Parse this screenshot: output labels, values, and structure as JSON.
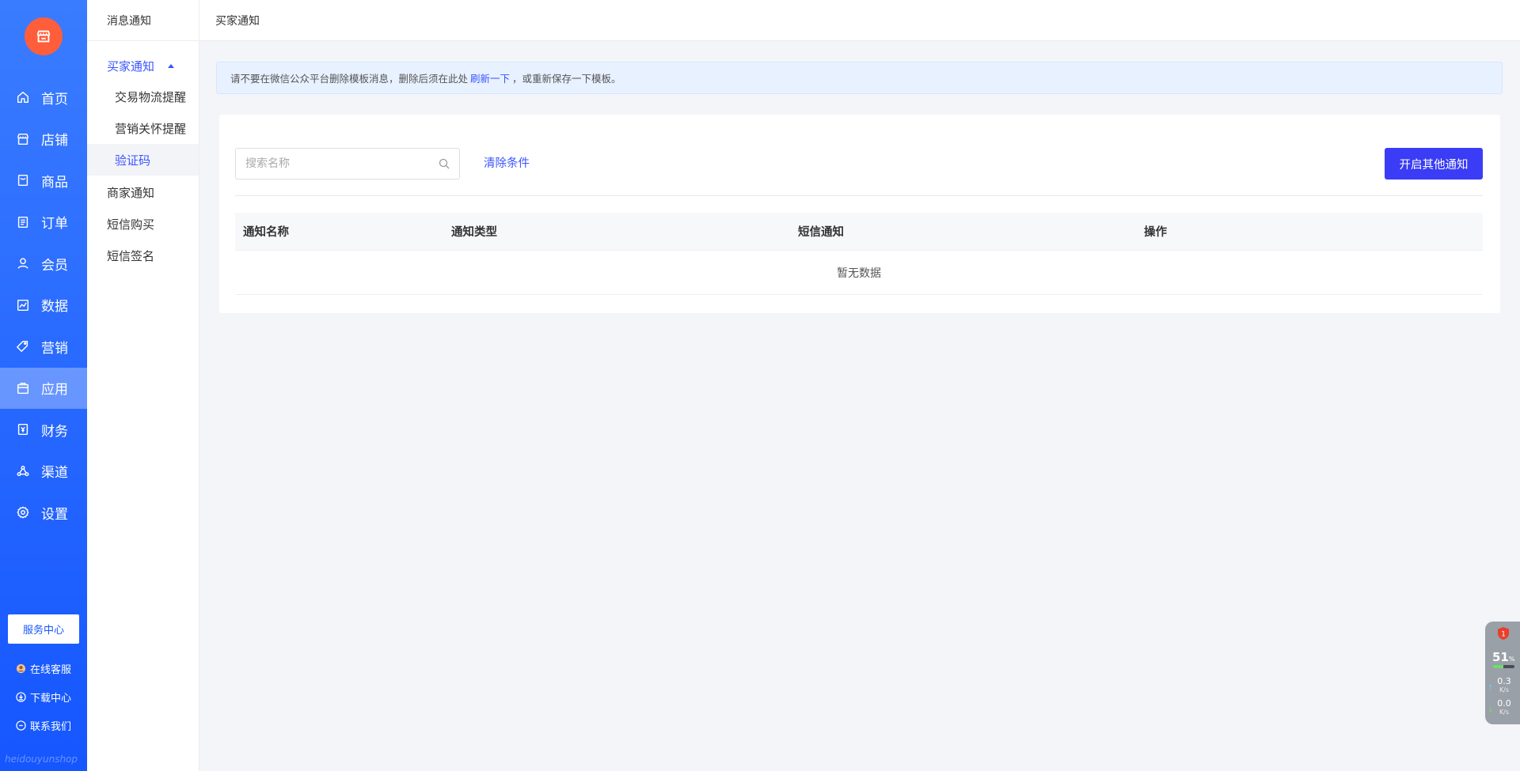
{
  "nav": {
    "items": [
      {
        "label": "首页",
        "icon": "home-icon"
      },
      {
        "label": "店铺",
        "icon": "store-icon"
      },
      {
        "label": "商品",
        "icon": "goods-icon"
      },
      {
        "label": "订单",
        "icon": "order-icon"
      },
      {
        "label": "会员",
        "icon": "member-icon"
      },
      {
        "label": "数据",
        "icon": "chart-icon"
      },
      {
        "label": "营销",
        "icon": "tag-icon"
      },
      {
        "label": "应用",
        "icon": "app-icon"
      },
      {
        "label": "财务",
        "icon": "finance-icon"
      },
      {
        "label": "渠道",
        "icon": "channel-icon"
      },
      {
        "label": "设置",
        "icon": "gear-icon"
      }
    ],
    "active_index": 7,
    "service_label": "服务中心",
    "online_service": "在线客服",
    "download_center": "下载中心",
    "contact_us": "联系我们",
    "watermark": "heidouyunshop"
  },
  "subnav": {
    "title": "消息通知",
    "group_buyer": "买家通知",
    "items": [
      "交易物流提醒",
      "营销关怀提醒",
      "验证码"
    ],
    "group_merchant": "商家通知",
    "group_sms_buy": "短信购买",
    "group_sms_sign": "短信签名"
  },
  "topbar": {
    "title": "买家通知"
  },
  "alert": {
    "before": "请不要在微信公众平台删除模板消息，删除后须在此处",
    "link": "刷新一下",
    "after": "，或重新保存一下模板。"
  },
  "search": {
    "placeholder": "搜索名称"
  },
  "clear_label": "清除条件",
  "primary_label": "开启其他通知",
  "table": {
    "headers": [
      "通知名称",
      "通知类型",
      "短信通知",
      "操作"
    ],
    "empty_text": "暂无数据"
  },
  "widget": {
    "percent": "51",
    "percent_unit": "%",
    "badge": "1",
    "cpu_fill": 0.51,
    "up_speed": "0.3",
    "down_speed": "0.0",
    "speed_unit": "K/s"
  },
  "colors": {
    "primary": "#3a54ff",
    "sidebar_top": "#3a7cff",
    "sidebar_bottom": "#1556ff",
    "logo": "#ff5e3a"
  }
}
